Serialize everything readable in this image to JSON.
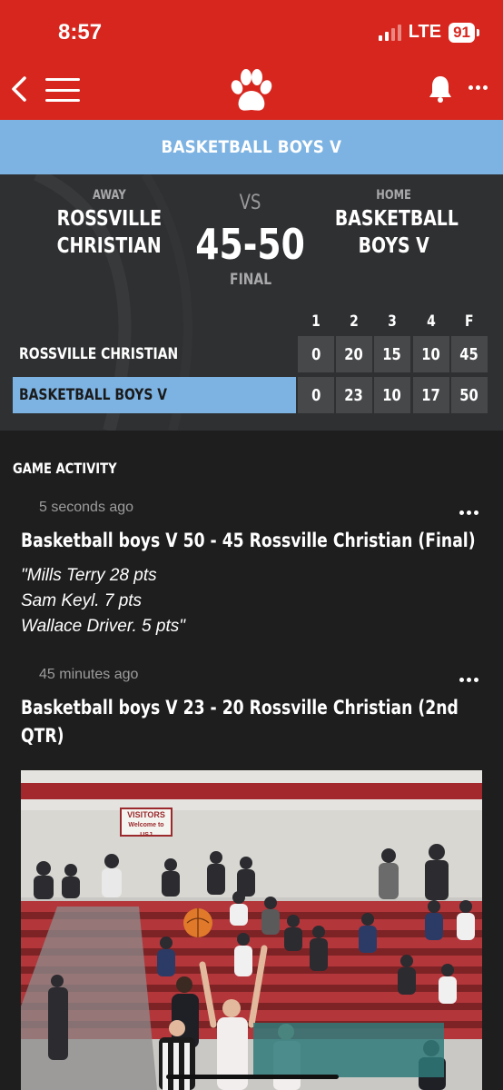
{
  "status_bar": {
    "time": "8:57",
    "network": "LTE",
    "battery": "91"
  },
  "header": {
    "back_icon": "chevron-left-icon",
    "menu_icon": "hamburger-icon",
    "logo_icon": "paw-icon",
    "bell_icon": "bell-icon",
    "more_icon": "more-dots-icon"
  },
  "banner": {
    "title": "BASKETBALL BOYS V"
  },
  "game": {
    "away_label": "AWAY",
    "away_name_line1": "ROSSVILLE",
    "away_name_line2": "CHRISTIAN",
    "vs": "VS",
    "score": "45-50",
    "status": "FINAL",
    "home_label": "HOME",
    "home_name_line1": "BASKETBALL",
    "home_name_line2": "BOYS V",
    "quarters": [
      "1",
      "2",
      "3",
      "4",
      "F"
    ],
    "rows": [
      {
        "team": "ROSSVILLE CHRISTIAN",
        "scores": [
          "0",
          "20",
          "15",
          "10",
          "45"
        ]
      },
      {
        "team": "BASKETBALL BOYS V",
        "scores": [
          "0",
          "23",
          "10",
          "17",
          "50"
        ]
      }
    ]
  },
  "activity": {
    "title": "GAME ACTIVITY",
    "posts": [
      {
        "time": "5 seconds ago",
        "title_line1": "Basketball boys V 50 - 45 Rossville Christian (Final)",
        "body": [
          "\"Mills Terry 28 pts",
          "Sam Keyl. 7 pts",
          "Wallace Driver. 5 pts\""
        ]
      },
      {
        "time": "45 minutes ago",
        "title_line1": "Basketball boys V 23 - 20 Rossville Christian (2nd",
        "title_line2": "QTR)"
      }
    ]
  },
  "photo": {
    "sign_line1": "VISITORS",
    "sign_line2": "Welcome to USJ"
  },
  "colors": {
    "brand_red": "#d7261e",
    "banner_blue": "#7db3e2",
    "scoreboard_bg": "#2f3032",
    "cell_bg": "#47484a",
    "page_bg": "#1e1e1e"
  }
}
